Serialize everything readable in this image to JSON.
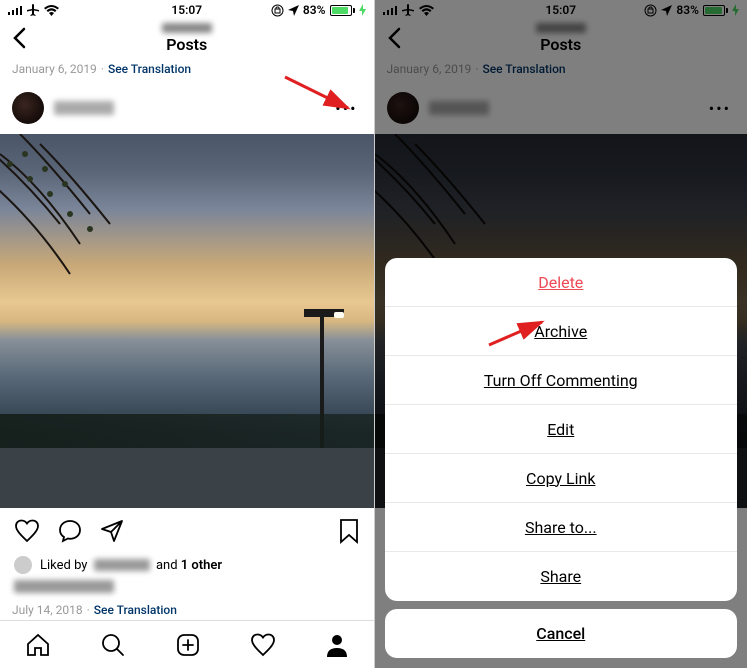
{
  "status": {
    "time": "15:07",
    "battery_pct": "83%",
    "signal_icon": "signal",
    "airplane_icon": "airplane",
    "wifi_icon": "wifi",
    "orientation_lock_icon": "orientation-lock",
    "location_icon": "location",
    "charging": true
  },
  "nav": {
    "title": "Posts",
    "back": "‹"
  },
  "meta_top": {
    "date": "January 6, 2019",
    "translate": "See Translation"
  },
  "post": {
    "more": "•••"
  },
  "actions": {
    "like": "heart",
    "comment": "comment",
    "share": "send",
    "bookmark": "bookmark"
  },
  "likes": {
    "prefix": "Liked by",
    "and": "and",
    "other": "1 other"
  },
  "meta_bottom": {
    "date": "July 14, 2018",
    "translate": "See Translation"
  },
  "bottomnav": {
    "home": "home",
    "search": "search",
    "add": "add",
    "activity": "activity",
    "profile": "profile"
  },
  "sheet": {
    "items": [
      {
        "label": "Delete",
        "danger": true
      },
      {
        "label": "Archive",
        "danger": false
      },
      {
        "label": "Turn Off Commenting",
        "danger": false
      },
      {
        "label": "Edit",
        "danger": false
      },
      {
        "label": "Copy Link",
        "danger": false
      },
      {
        "label": "Share to...",
        "danger": false
      },
      {
        "label": "Share",
        "danger": false
      }
    ],
    "cancel": "Cancel"
  }
}
